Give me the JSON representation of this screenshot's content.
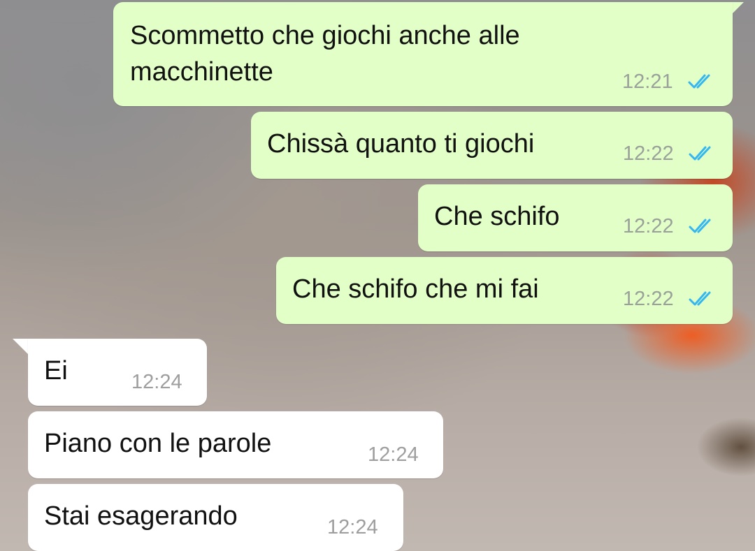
{
  "messages": [
    {
      "direction": "outgoing",
      "text_line1": "Scommetto che giochi anche alle",
      "text_line2": "macchinette",
      "time": "12:21",
      "status": "read"
    },
    {
      "direction": "outgoing",
      "text": "Chissà quanto ti giochi",
      "time": "12:22",
      "status": "read"
    },
    {
      "direction": "outgoing",
      "text": "Che schifo",
      "time": "12:22",
      "status": "read"
    },
    {
      "direction": "outgoing",
      "text": "Che schifo che mi fai",
      "time": "12:22",
      "status": "read"
    },
    {
      "direction": "incoming",
      "text": "Ei",
      "time": "12:24"
    },
    {
      "direction": "incoming",
      "text": "Piano con le parole",
      "time": "12:24"
    },
    {
      "direction": "incoming",
      "text": "Stai esagerando",
      "time": "12:24"
    }
  ],
  "colors": {
    "outgoing_bubble": "#e2ffc7",
    "incoming_bubble": "#ffffff",
    "read_ticks": "#34b7f1"
  },
  "icons": {
    "read_status": "double-check-icon"
  }
}
